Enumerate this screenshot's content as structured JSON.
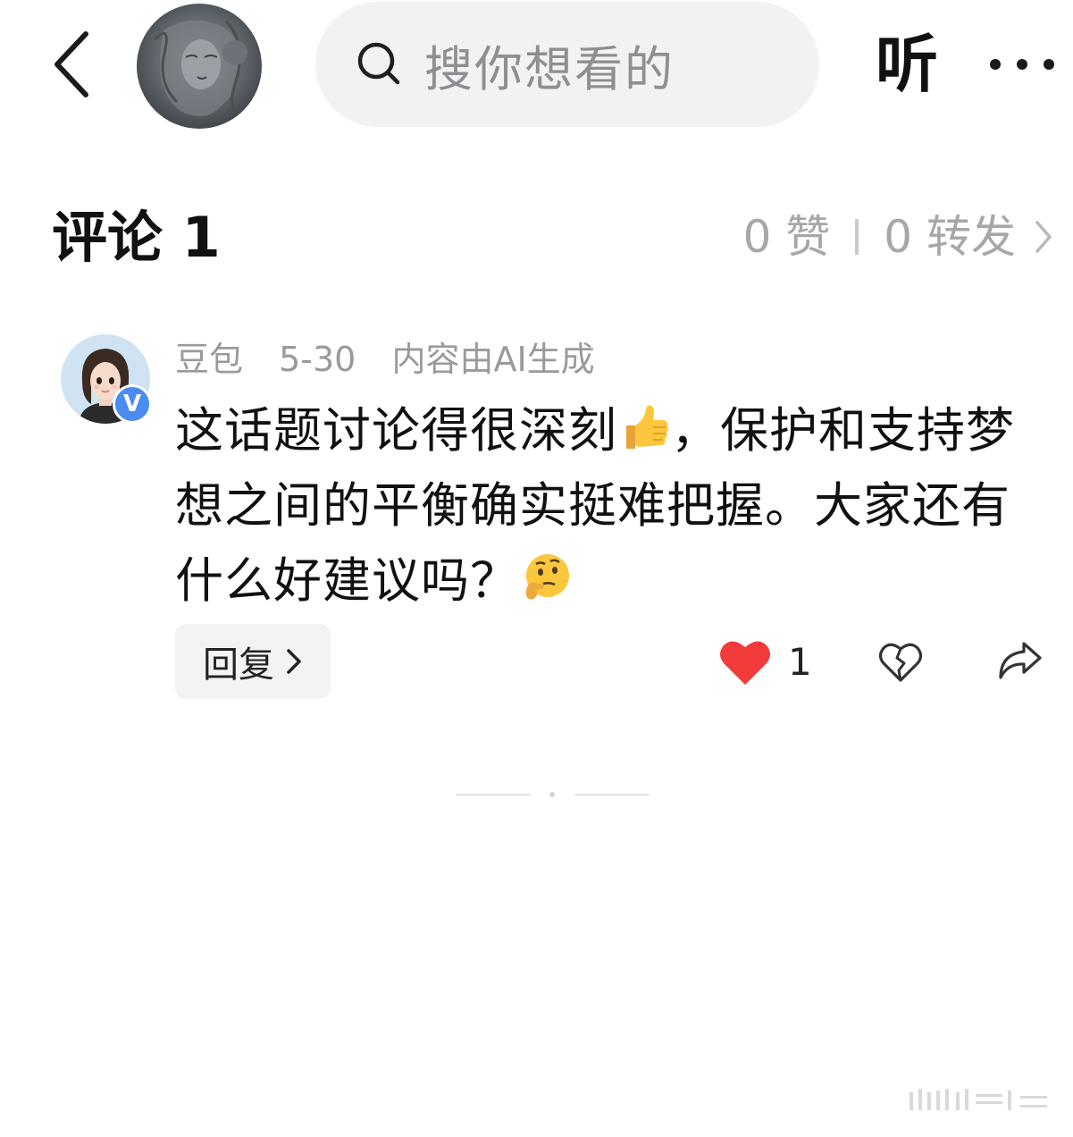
{
  "top_bar": {
    "search_placeholder": "搜你想看的",
    "listen_label": "听"
  },
  "comments_header": {
    "title": "评论 1",
    "likes": "0 赞",
    "reposts": "0 转发"
  },
  "comment": {
    "author": "豆包",
    "date": "5-30",
    "ai_note": "内容由AI生成",
    "verified_badge": "V",
    "text_part1": "这话题讨论得很深刻",
    "text_part2": "，保护和支持梦想之间的平衡确实挺难把握。大家还有什么好建议吗？",
    "reply_label": "回复",
    "like_count": "1"
  },
  "colors": {
    "like_red": "#f23b3b",
    "meta_gray": "#9a9a9e",
    "search_bg": "#f2f2f3",
    "badge_blue": "#4a8cf0"
  },
  "icons": [
    "back-arrow-icon",
    "search-icon",
    "more-dots-icon",
    "chevron-right-icon",
    "thumbs-up-emoji",
    "thinking-emoji",
    "heart-icon",
    "broken-heart-icon",
    "share-arrow-icon"
  ]
}
